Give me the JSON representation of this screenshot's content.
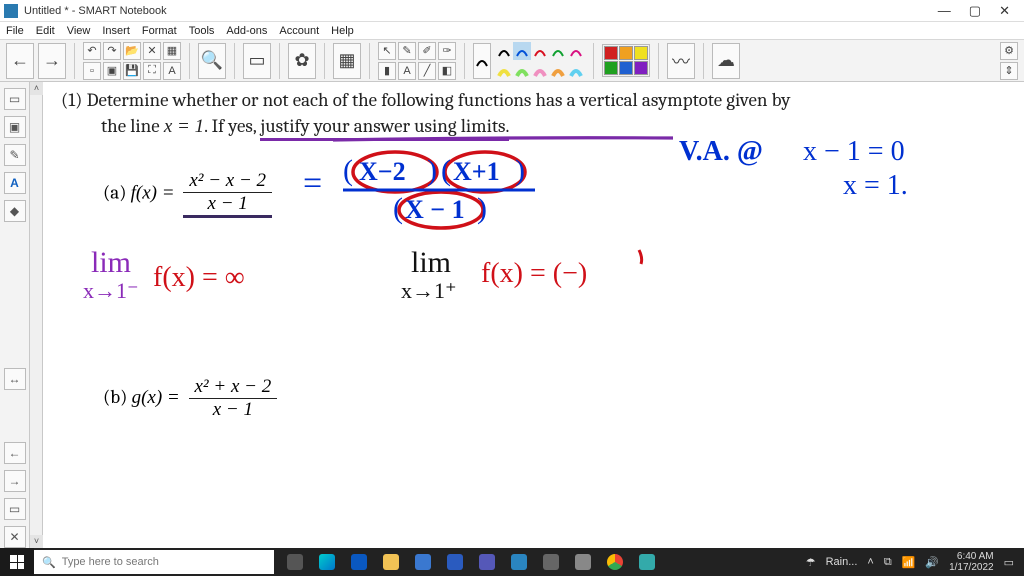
{
  "window": {
    "title": "Untitled * - SMART Notebook",
    "minimize": "—",
    "restore": "▢",
    "close": "✕"
  },
  "menu": {
    "file": "File",
    "edit": "Edit",
    "view": "View",
    "insert": "Insert",
    "format": "Format",
    "tools": "Tools",
    "addons": "Add-ons",
    "account": "Account",
    "help": "Help"
  },
  "toolbar": {
    "back": "←",
    "forward": "→",
    "undo": "↶",
    "redo": "↷",
    "open": "📂",
    "delete": "✕",
    "table": "▦",
    "new": "▫",
    "paste": "▣",
    "save": "💾",
    "screen": "⛶",
    "textA": "A",
    "zoom": "🔍",
    "camera": "▭",
    "bug": "✿",
    "grid": "▦",
    "pointer": "↖",
    "pen1": "✎",
    "pen2": "✐",
    "pen3": "✑",
    "ruler": "▮",
    "textT": "A",
    "line": "╱",
    "eraser": "◧",
    "gear": "⚙",
    "expand": "⇕"
  },
  "lefttools": {
    "page": "▭",
    "frame": "▣",
    "pen": "✎",
    "textA": "A",
    "shape": "◆",
    "move": "↔",
    "prev": "←",
    "next": "→",
    "dup": "▭",
    "del": "✕"
  },
  "problem": {
    "num": "(1)",
    "line1a": "Determine whether or not each of the following functions has a vertical asymptote given by",
    "line2a": "the line ",
    "xeq1": "x = 1",
    "line2b": ". If yes, ",
    "justify": "justify your answer using limits."
  },
  "partA": {
    "label": "(a) ",
    "fx": "f(x) = ",
    "num": "x² − x − 2",
    "den": "x − 1"
  },
  "partB": {
    "label": "(b) ",
    "gx": "g(x) = ",
    "num": "x² + x − 2",
    "den": "x − 1"
  },
  "hand": {
    "blue_equals": "=",
    "fact1": "X−2",
    "fact2": "X+1",
    "factD": "X − 1",
    "va": "V.A. @",
    "va_eq": "x − 1 = 0",
    "va_sol": "x = 1.",
    "limL1": "lim",
    "limL2": "x→1⁻",
    "limL3": "f(x) = ∞",
    "limR1": "lim",
    "limR2": "x→1⁺",
    "limR3": "f(x) = (−)"
  },
  "taskbar": {
    "search_placeholder": "Type here to search",
    "weather": "Rain...",
    "time": "6:40 AM",
    "date": "1/17/2022"
  }
}
